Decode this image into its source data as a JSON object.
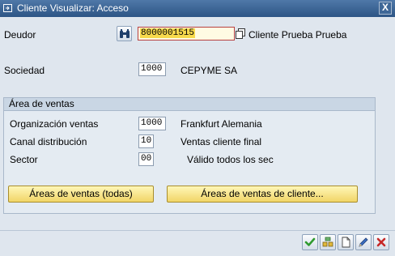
{
  "window": {
    "title": "Cliente Visualizar: Acceso",
    "close_glyph": "X"
  },
  "fields": {
    "deudor": {
      "label": "Deudor",
      "value": "8000001515",
      "description": "Cliente Prueba Prueba"
    },
    "sociedad": {
      "label": "Sociedad",
      "value": "1000",
      "description": "CEPYME SA"
    }
  },
  "sales_area": {
    "title": "Área de ventas",
    "org": {
      "label": "Organización ventas",
      "value": "1000",
      "description": "Frankfurt Alemania"
    },
    "canal": {
      "label": "Canal distribución",
      "value": "10",
      "description": "Ventas cliente final"
    },
    "sector": {
      "label": "Sector",
      "value": "00",
      "description": "Válido todos los sec"
    },
    "buttons": {
      "all": "Áreas de ventas (todas)",
      "client": "Áreas de ventas de cliente..."
    }
  },
  "toolbar": {
    "icons": [
      "check-icon",
      "multi-select-icon",
      "new-document-icon",
      "edit-pencil-icon",
      "cancel-icon"
    ]
  },
  "colors": {
    "title_bar": "#2d5585",
    "button_yellow": "#f1d567",
    "focus_highlight": "#f7d94c",
    "confirm_green": "#2f9a2f",
    "cancel_red": "#c62828"
  }
}
